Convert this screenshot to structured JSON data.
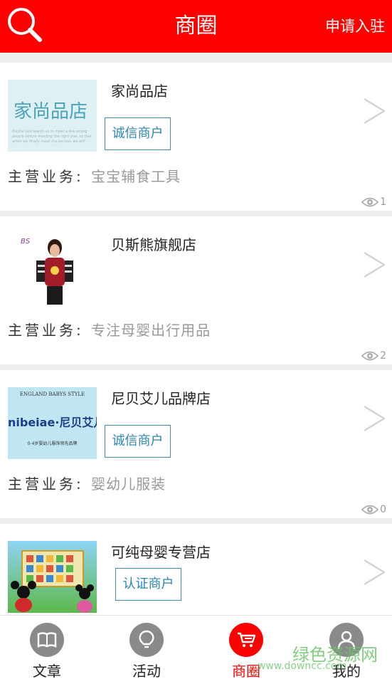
{
  "header": {
    "title": "商圈",
    "apply_label": "申请入驻",
    "search_icon": "search-icon"
  },
  "shops": [
    {
      "name": "家尚品店",
      "badge": "诚信商户",
      "business_key": "主营业务:",
      "business": "宝宝辅食工具",
      "views": "1",
      "logo_text": "家尚品店",
      "logo_sub": "Maybe God wants us to meet a few wrong people before meeting the right one, so that when we finally meet the person, we will know how to be grateful"
    },
    {
      "name": "贝斯熊旗舰店",
      "badge": "",
      "business_key": "主营业务:",
      "business": "专注母婴出行用品",
      "views": "2",
      "logo_text": "BS"
    },
    {
      "name": "尼贝艾儿品牌店",
      "badge": "诚信商户",
      "business_key": "主营业务:",
      "business": "婴幼儿服装",
      "views": "0",
      "logo_text": "ENGLAND BABYS STYLE",
      "logo_brand": "nibeiae·尼贝艾儿",
      "logo_sub": "0-4岁婴幼儿服饰领先品牌"
    },
    {
      "name": "可纯母婴专营店",
      "badge": "认证商户",
      "business_key": "",
      "business": "",
      "views": ""
    }
  ],
  "tabs": [
    {
      "label": "文章",
      "icon": "book-icon"
    },
    {
      "label": "活动",
      "icon": "bulb-icon"
    },
    {
      "label": "商圈",
      "icon": "cart-icon"
    },
    {
      "label": "我的",
      "icon": "user-icon"
    }
  ],
  "watermark": {
    "text": "绿色资源网",
    "url": "www.downcc.com"
  },
  "colors": {
    "primary": "#ff0000",
    "badge": "#2a86b0",
    "inactive": "#8a8a8a"
  }
}
